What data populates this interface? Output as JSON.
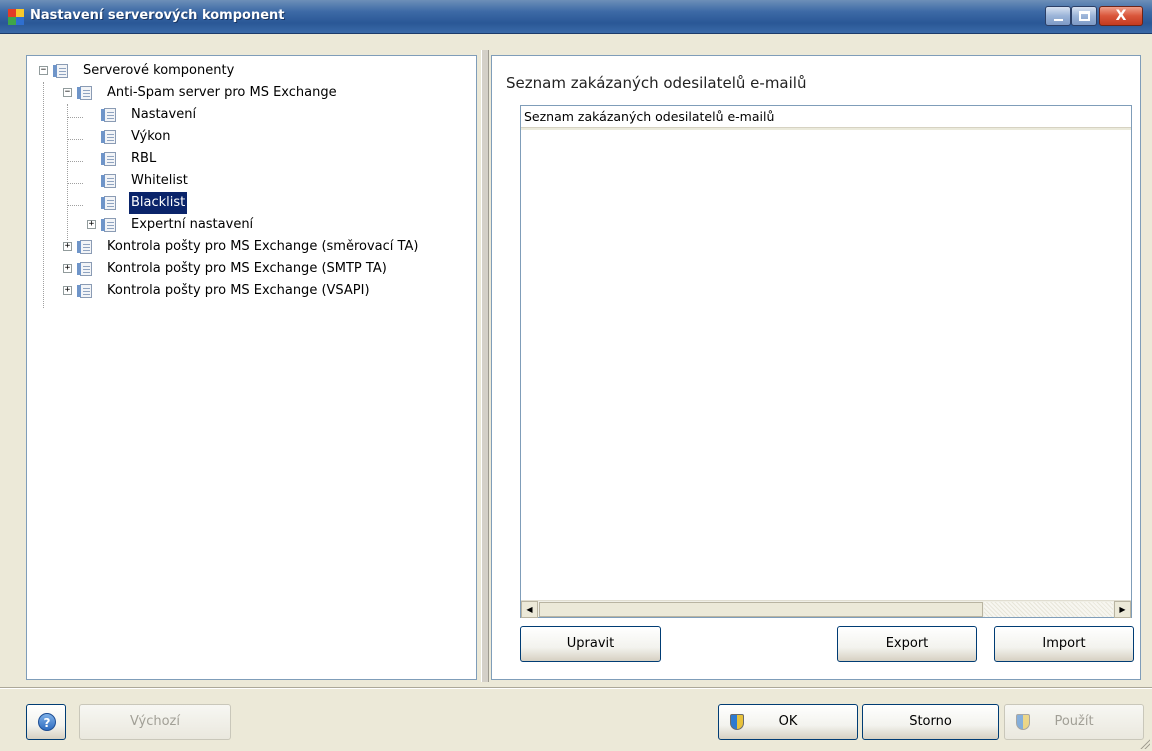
{
  "window": {
    "title": "Nastavení serverových komponent",
    "controls": [
      "minimize-icon",
      "maximize-icon",
      "close-icon"
    ],
    "close_glyph": "X"
  },
  "tree": {
    "root": "Serverové komponenty",
    "antispam": "Anti-Spam server pro MS Exchange",
    "children": [
      "Nastavení",
      "Výkon",
      "RBL",
      "Whitelist",
      "Blacklist",
      "Expertní nastavení"
    ],
    "selected": "Blacklist",
    "others": [
      "Kontrola pošty pro MS Exchange (směrovací TA)",
      "Kontrola pošty pro MS Exchange (SMTP TA)",
      "Kontrola pošty pro MS Exchange (VSAPI)"
    ]
  },
  "panel": {
    "heading": "Seznam zakázaných odesilatelů e-mailů",
    "list_header": "Seznam zakázaných odesilatelů e-mailů",
    "rows": [],
    "edit_button": "Upravit",
    "export_button": "Export",
    "import_button": "Import"
  },
  "footer": {
    "help_icon": "?",
    "default_button": "Výchozí",
    "ok_button": "OK",
    "cancel_button": "Storno",
    "apply_button": "Použít"
  },
  "colors": {
    "selection": "#0a246a",
    "titlebar": "#2a5796",
    "dialog_bg": "#ece9d8"
  }
}
